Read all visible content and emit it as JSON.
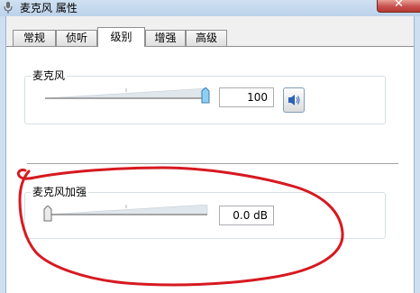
{
  "window": {
    "title": "麦克风 属性",
    "close_label": "✕"
  },
  "tabs": [
    {
      "label": "常规",
      "active": false
    },
    {
      "label": "侦听",
      "active": false
    },
    {
      "label": "级别",
      "active": true
    },
    {
      "label": "增强",
      "active": false
    },
    {
      "label": "高级",
      "active": false
    }
  ],
  "microphone": {
    "label": "麦克风",
    "value": "100",
    "level": 1.0,
    "mute_icon": "speaker-icon"
  },
  "boost": {
    "label": "麦克风加强",
    "value": "0.0 dB",
    "level": 0.0
  },
  "colors": {
    "annotation": "#d71920",
    "accent": "#5a9bd5",
    "panel": "#ffffff"
  }
}
